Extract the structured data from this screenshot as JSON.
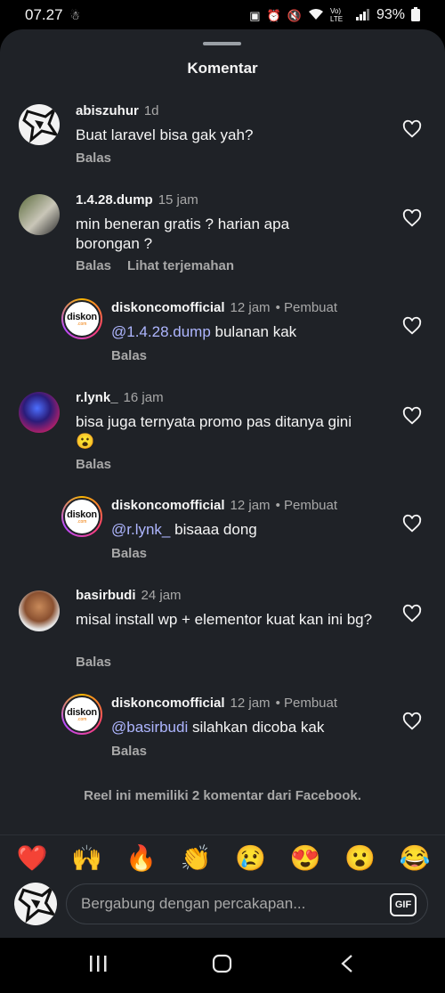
{
  "status_bar": {
    "time": "07.27",
    "battery": "93%",
    "network": "Vo) LTE"
  },
  "sheet": {
    "title": "Komentar"
  },
  "comments": [
    {
      "username": "abiszuhur",
      "time": "1d",
      "text": "Buat laravel bisa gak yah?",
      "actions": [
        "Balas"
      ],
      "avatar": "abstract-star-avatar"
    },
    {
      "username": "1.4.28.dump",
      "time": "15 jam",
      "text": "min beneran gratis ? harian apa borongan ?",
      "actions": [
        "Balas",
        "Lihat terjemahan"
      ],
      "avatar": "photo-avatar"
    },
    {
      "username": "diskoncomofficial",
      "time": "12 jam",
      "creator": "• Pembuat",
      "mention": "@1.4.28.dump",
      "text": " bulanan kak",
      "actions": [
        "Balas"
      ],
      "avatar": "diskon-logo",
      "reply": true
    },
    {
      "username": "r.lynk_",
      "time": "16 jam",
      "text": "bisa juga ternyata promo pas ditanya gini",
      "emoji": "😮",
      "actions": [
        "Balas"
      ],
      "avatar": "game-avatar"
    },
    {
      "username": "diskoncomofficial",
      "time": "12 jam",
      "creator": "• Pembuat",
      "mention": "@r.lynk_",
      "text": " bisaaa dong",
      "actions": [
        "Balas"
      ],
      "avatar": "diskon-logo",
      "reply": true
    },
    {
      "username": "basirbudi",
      "time": "24 jam",
      "text": "misal install wp + elementor kuat kan ini bg?",
      "actions": [
        "Balas"
      ],
      "avatar": "person-avatar"
    },
    {
      "username": "diskoncomofficial",
      "time": "12 jam",
      "creator": "• Pembuat",
      "mention": "@basirbudi",
      "text": " silahkan dicoba kak",
      "actions": [
        "Balas"
      ],
      "avatar": "diskon-logo",
      "reply": true
    }
  ],
  "brand_logo": {
    "main": "diskon",
    "sub": ".com"
  },
  "facebook_note": "Reel ini memiliki 2 komentar dari Facebook.",
  "emoji_bar": [
    "❤️",
    "🙌",
    "🔥",
    "👏",
    "😢",
    "😍",
    "😮",
    "😂"
  ],
  "composer": {
    "placeholder": "Bergabung dengan percakapan...",
    "gif_label": "GIF"
  },
  "colors": {
    "sheet_bg": "#1f2227",
    "mention": "#aeb6ff",
    "secondary_text": "#a8a8a8"
  }
}
